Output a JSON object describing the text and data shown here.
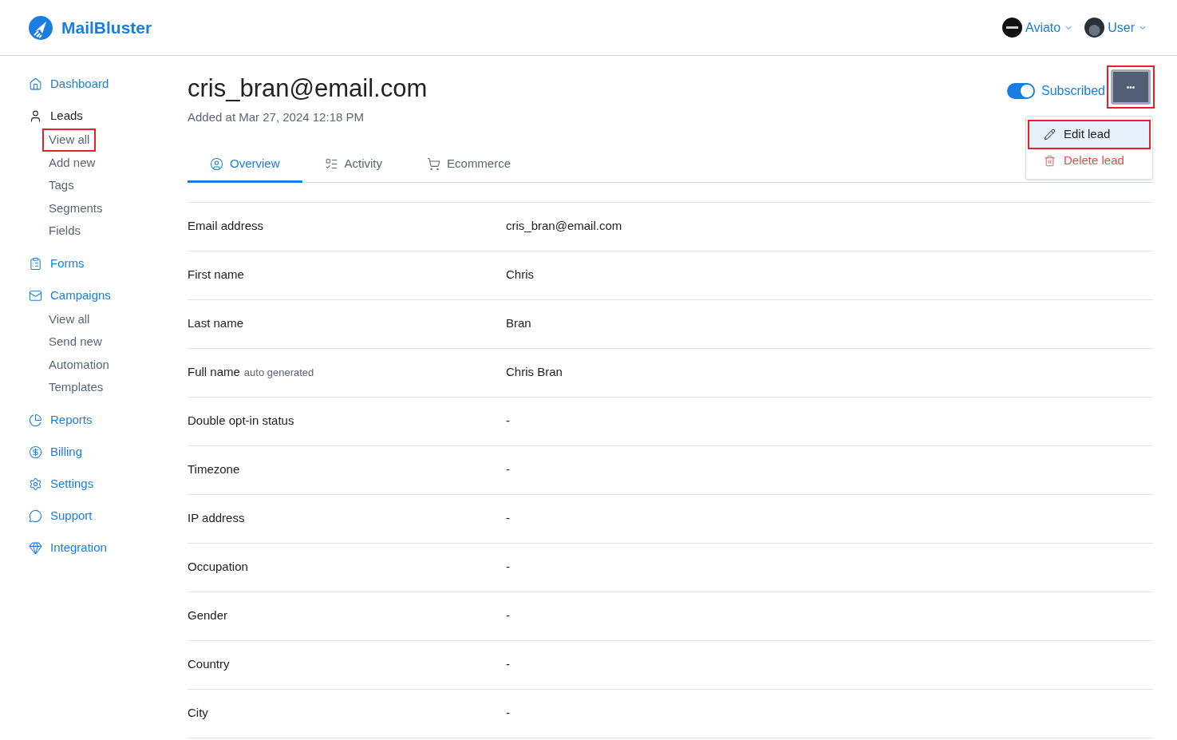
{
  "brand": {
    "name": "MailBluster"
  },
  "header": {
    "menus": [
      {
        "label": "Aviato",
        "kind": "org"
      },
      {
        "label": "User",
        "kind": "user"
      }
    ]
  },
  "sidebar": {
    "items": [
      {
        "label": "Dashboard",
        "selected": false
      },
      {
        "label": "Leads",
        "selected": true,
        "children": [
          {
            "label": "View all",
            "highlighted": true
          },
          {
            "label": "Add new",
            "highlighted": false
          },
          {
            "label": "Tags",
            "highlighted": false
          },
          {
            "label": "Segments",
            "highlighted": false
          },
          {
            "label": "Fields",
            "highlighted": false
          }
        ]
      },
      {
        "label": "Forms",
        "selected": false
      },
      {
        "label": "Campaigns",
        "selected": false,
        "children": [
          {
            "label": "View all",
            "highlighted": false
          },
          {
            "label": "Send new",
            "highlighted": false
          },
          {
            "label": "Automation",
            "highlighted": false
          },
          {
            "label": "Templates",
            "highlighted": false
          }
        ]
      },
      {
        "label": "Reports",
        "selected": false
      },
      {
        "label": "Billing",
        "selected": false
      },
      {
        "label": "Settings",
        "selected": false
      },
      {
        "label": "Support",
        "selected": false
      },
      {
        "label": "Integration",
        "selected": false
      }
    ]
  },
  "lead": {
    "title": "cris_bran@email.com",
    "added": "Added at Mar 27, 2024 12:18 PM"
  },
  "subscription": {
    "label": "Subscribed",
    "on": true
  },
  "more_button": {
    "label": "•••",
    "highlighted": true
  },
  "menu": {
    "items": [
      {
        "label": "Edit lead",
        "kind": "edit",
        "highlighted": true
      },
      {
        "label": "Delete lead",
        "kind": "delete",
        "highlighted": false
      }
    ]
  },
  "tabs": [
    {
      "label": "Overview",
      "selected": true
    },
    {
      "label": "Activity",
      "selected": false
    },
    {
      "label": "Ecommerce",
      "selected": false
    }
  ],
  "fields": [
    {
      "label": "Email address",
      "value": "cris_bran@email.com"
    },
    {
      "label": "First name",
      "value": "Chris"
    },
    {
      "label": "Last name",
      "value": "Bran"
    },
    {
      "label": "Full name",
      "note": "auto generated",
      "value": "Chris Bran"
    },
    {
      "label": "Double opt-in status",
      "value": "-"
    },
    {
      "label": "Timezone",
      "value": "-"
    },
    {
      "label": "IP address",
      "value": "-"
    },
    {
      "label": "Occupation",
      "value": "-"
    },
    {
      "label": "Gender",
      "value": "-"
    },
    {
      "label": "Country",
      "value": "-"
    },
    {
      "label": "City",
      "value": "-"
    }
  ]
}
